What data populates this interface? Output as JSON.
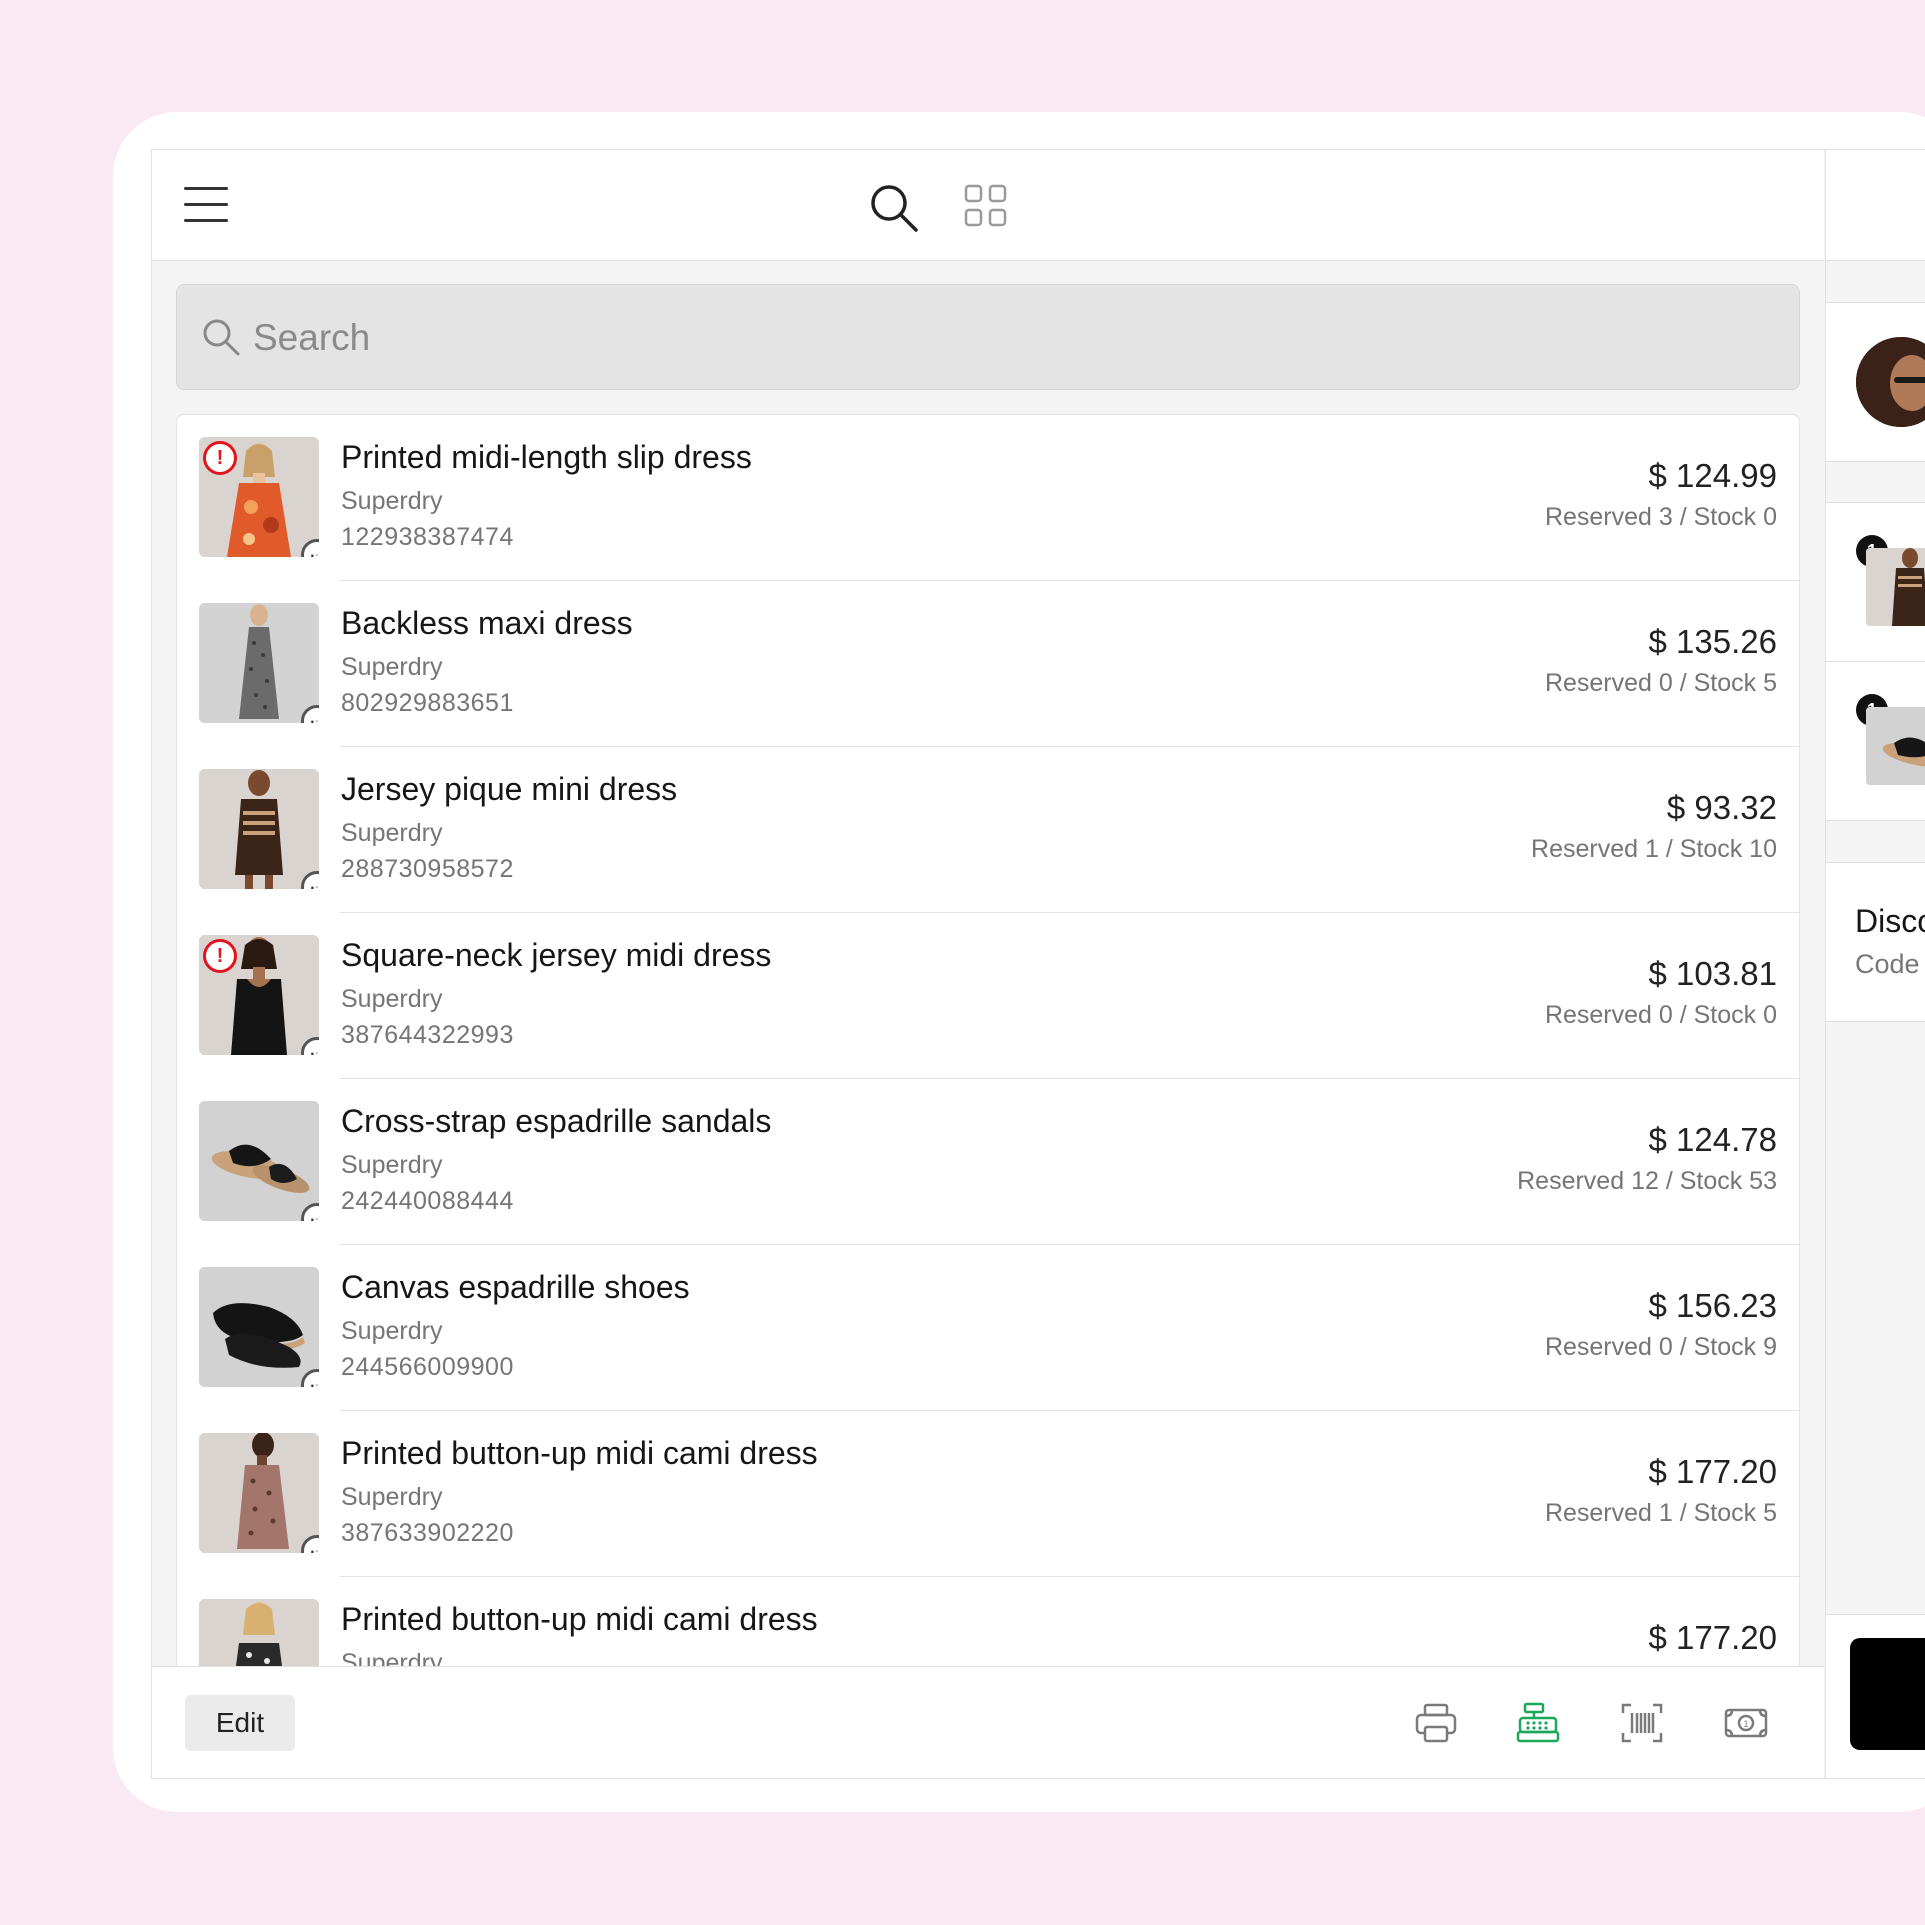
{
  "topbar": {
    "menu_icon": "hamburger-menu-icon",
    "view_icons": [
      "search-icon",
      "grid-view-icon"
    ]
  },
  "search": {
    "placeholder": "Search",
    "icon": "search-icon"
  },
  "products": [
    {
      "name": "Printed midi-length slip dress",
      "brand": "Superdry",
      "code": "122938387474",
      "price": "$ 124.99",
      "stock": "Reserved 3 / Stock 0",
      "alert": true,
      "image": "orange-floral-slip-dress"
    },
    {
      "name": "Backless maxi dress",
      "brand": "Superdry",
      "code": "802929883651",
      "price": "$ 135.26",
      "stock": "Reserved 0 / Stock 5",
      "alert": false,
      "image": "grey-print-maxi-dress"
    },
    {
      "name": "Jersey pique mini dress",
      "brand": "Superdry",
      "code": "288730958572",
      "price": "$ 93.32",
      "stock": "Reserved 1 / Stock 10",
      "alert": false,
      "image": "brown-striped-mini-dress"
    },
    {
      "name": "Square-neck jersey midi dress",
      "brand": "Superdry",
      "code": "387644322993",
      "price": "$ 103.81",
      "stock": "Reserved 0 / Stock 0",
      "alert": true,
      "image": "black-jersey-midi-dress"
    },
    {
      "name": "Cross-strap espadrille sandals",
      "brand": "Superdry",
      "code": "242440088444",
      "price": "$ 124.78",
      "stock": "Reserved 12 / Stock 53",
      "alert": false,
      "image": "black-espadrille-sandals"
    },
    {
      "name": "Canvas espadrille shoes",
      "brand": "Superdry",
      "code": "244566009900",
      "price": "$ 156.23",
      "stock": "Reserved 0 / Stock 9",
      "alert": false,
      "image": "black-canvas-espadrilles"
    },
    {
      "name": "Printed button-up midi cami dress",
      "brand": "Superdry",
      "code": "387633902220",
      "price": "$ 177.20",
      "stock": "Reserved 1 / Stock 5",
      "alert": false,
      "image": "floral-cami-dress"
    },
    {
      "name": "Printed button-up midi cami dress",
      "brand": "Superdry",
      "code": "",
      "price": "$ 177.20",
      "stock": "",
      "alert": false,
      "image": "floral-cami-dress-2"
    }
  ],
  "bottombar": {
    "edit_label": "Edit",
    "icons": [
      "printer-icon",
      "cash-register-icon",
      "barcode-scanner-icon",
      "cash-icon"
    ],
    "active_color": "#1aa85a"
  },
  "right_panel": {
    "cart_items": [
      {
        "qty": "1"
      },
      {
        "qty": "1"
      }
    ],
    "discount_title": "Disco",
    "discount_sub": "Code"
  },
  "colors": {
    "background": "#f9e9f3",
    "alert": "#e0151f",
    "accent_green": "#1aa85a"
  }
}
